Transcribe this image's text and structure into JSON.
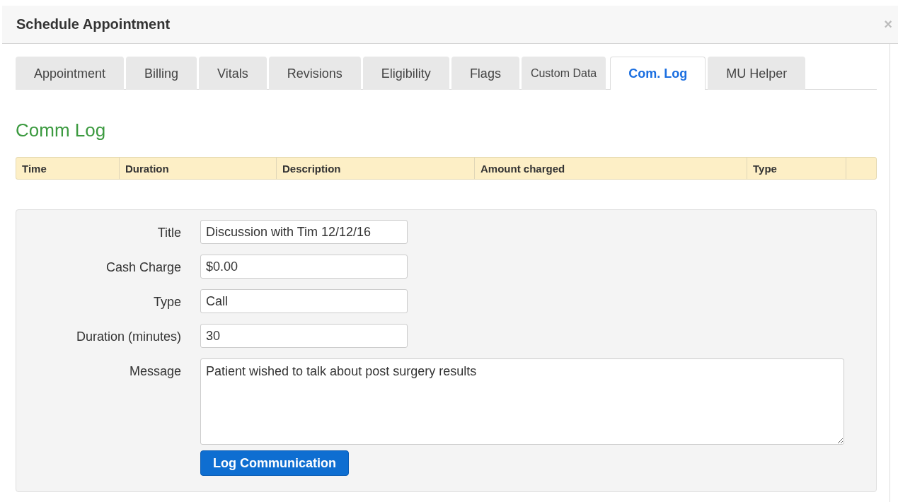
{
  "window": {
    "title": "Schedule Appointment",
    "close": "×"
  },
  "tabs": [
    {
      "label": "Appointment",
      "selected": false
    },
    {
      "label": "Billing",
      "selected": false
    },
    {
      "label": "Vitals",
      "selected": false
    },
    {
      "label": "Revisions",
      "selected": false
    },
    {
      "label": "Eligibility",
      "selected": false
    },
    {
      "label": "Flags",
      "selected": false
    },
    {
      "label": "Custom Data",
      "selected": false,
      "small": true
    },
    {
      "label": "Com. Log",
      "selected": true
    },
    {
      "label": "MU Helper",
      "selected": false
    }
  ],
  "section_title": "Comm Log",
  "table": {
    "columns": [
      "Time",
      "Duration",
      "Description",
      "Amount charged",
      "Type"
    ]
  },
  "form": {
    "fields": [
      {
        "label": "Title",
        "value": "Discussion with Tim 12/12/16",
        "kind": "text"
      },
      {
        "label": "Cash Charge",
        "value": "$0.00",
        "kind": "text"
      },
      {
        "label": "Type",
        "value": "Call",
        "kind": "text"
      },
      {
        "label": "Duration (minutes)",
        "value": "30",
        "kind": "text"
      },
      {
        "label": "Message",
        "value": "Patient wished to talk about post surgery results",
        "kind": "textarea"
      }
    ],
    "submit": "Log Communication"
  }
}
